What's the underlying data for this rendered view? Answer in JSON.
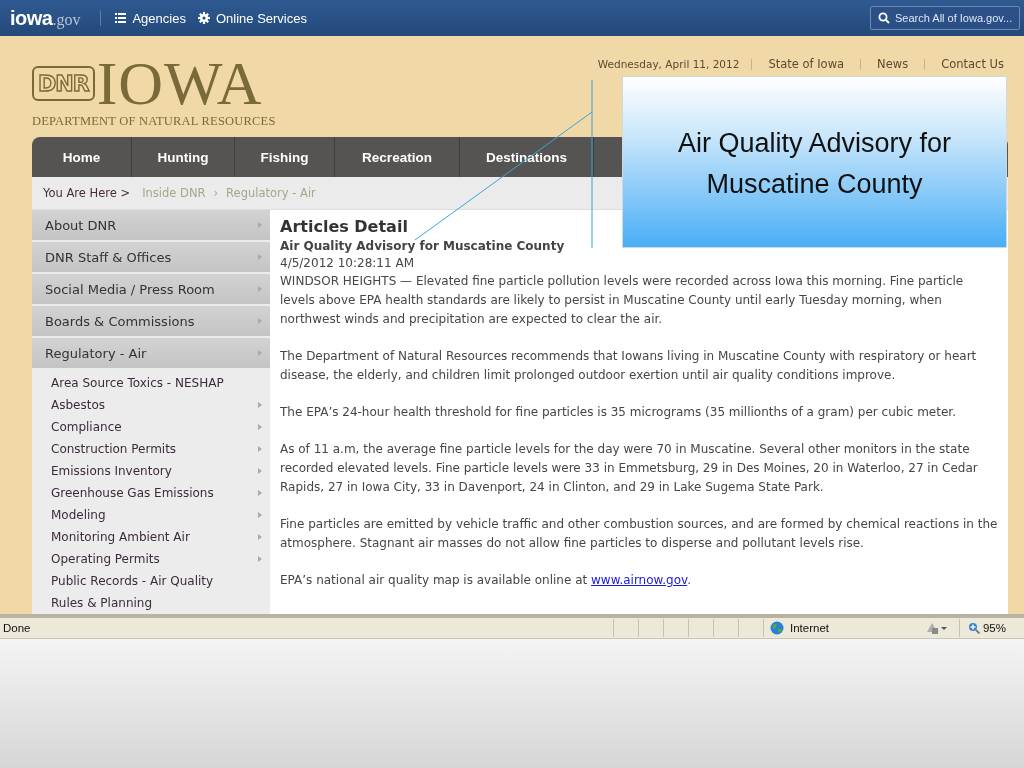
{
  "topbar": {
    "logo": "iowa",
    "logo_suffix": ".gov",
    "links": [
      {
        "label": "Agencies",
        "kind": "list"
      },
      {
        "label": "Online Services",
        "kind": "gear"
      }
    ],
    "search": {
      "placeholder": "Search All of Iowa.gov..."
    }
  },
  "header": {
    "logo_mark": "DNR",
    "logo_title": "IOWA",
    "logo_subtitle": "DEPARTMENT OF NATURAL RESOURCES",
    "date": "Wednesday, April 11, 2012",
    "links": [
      "State of Iowa",
      "News",
      "Contact Us"
    ]
  },
  "nav": [
    {
      "label": "Home"
    },
    {
      "label": "Hunting"
    },
    {
      "label": "Fishing"
    },
    {
      "label": "Recreation"
    },
    {
      "label": "Destinations"
    }
  ],
  "breadcrumb": {
    "label": "You Are Here >",
    "separator": "›",
    "items": [
      "Inside DNR",
      "Regulatory - Air"
    ]
  },
  "sidebar": {
    "items": [
      {
        "label": "About DNR"
      },
      {
        "label": "DNR Staff & Offices"
      },
      {
        "label": "Social Media / Press Room"
      },
      {
        "label": "Boards & Commissions"
      },
      {
        "label": "Regulatory - Air",
        "children": [
          {
            "label": "Area Source Toxics - NESHAP",
            "has_submenu": false
          },
          {
            "label": "Asbestos",
            "has_submenu": true
          },
          {
            "label": "Compliance",
            "has_submenu": true
          },
          {
            "label": "Construction Permits",
            "has_submenu": true
          },
          {
            "label": "Emissions Inventory",
            "has_submenu": true
          },
          {
            "label": "Greenhouse Gas Emissions",
            "has_submenu": true
          },
          {
            "label": "Modeling",
            "has_submenu": true
          },
          {
            "label": "Monitoring Ambient Air",
            "has_submenu": true
          },
          {
            "label": "Operating Permits",
            "has_submenu": true
          },
          {
            "label": "Public Records - Air Quality",
            "has_submenu": false
          },
          {
            "label": "Rules & Planning",
            "has_submenu": false
          }
        ]
      }
    ]
  },
  "article": {
    "title": "Articles Detail",
    "headline": "Air Quality Advisory for Muscatine County",
    "date": "4/5/2012 10:28:11 AM",
    "paragraphs": [
      {
        "text": "WINDSOR HEIGHTS — Elevated fine particle pollution levels were recorded across Iowa this morning. Fine particle levels above EPA health standards are likely to persist in Muscatine County until early Tuesday morning, when northwest winds and precipitation are expected to clear the air."
      },
      {
        "text": "The Department of Natural Resources recommends that Iowans living in Muscatine County with respiratory or heart disease, the elderly, and children limit prolonged outdoor exertion until air quality conditions improve."
      },
      {
        "text": "The EPA’s 24-hour health threshold for fine particles is 35 micrograms (35 millionths of a gram) per cubic meter."
      },
      {
        "text": "As of 11 a.m, the average fine particle levels for the day were 70 in Muscatine. Several other monitors in the state recorded elevated levels.  Fine particle levels were 33 in Emmetsburg, 29 in Des Moines, 20 in Waterloo, 27 in Cedar Rapids, 27 in Iowa City, 33 in Davenport, 24 in Clinton, and 29 in Lake Sugema State Park."
      },
      {
        "text": "Fine particles are emitted by vehicle traffic and other combustion sources, and are formed by chemical reactions in the atmosphere. Stagnant air masses do not allow fine particles to disperse and pollutant levels rise."
      },
      {
        "text": "EPA’s national air quality map is available online at ",
        "link": "www.airnow.gov",
        "after": "."
      }
    ]
  },
  "callout": {
    "text": "Air Quality Advisory for Muscatine County"
  },
  "status_bar": {
    "text": "Done",
    "zone": "Internet",
    "zoom": "95%"
  }
}
